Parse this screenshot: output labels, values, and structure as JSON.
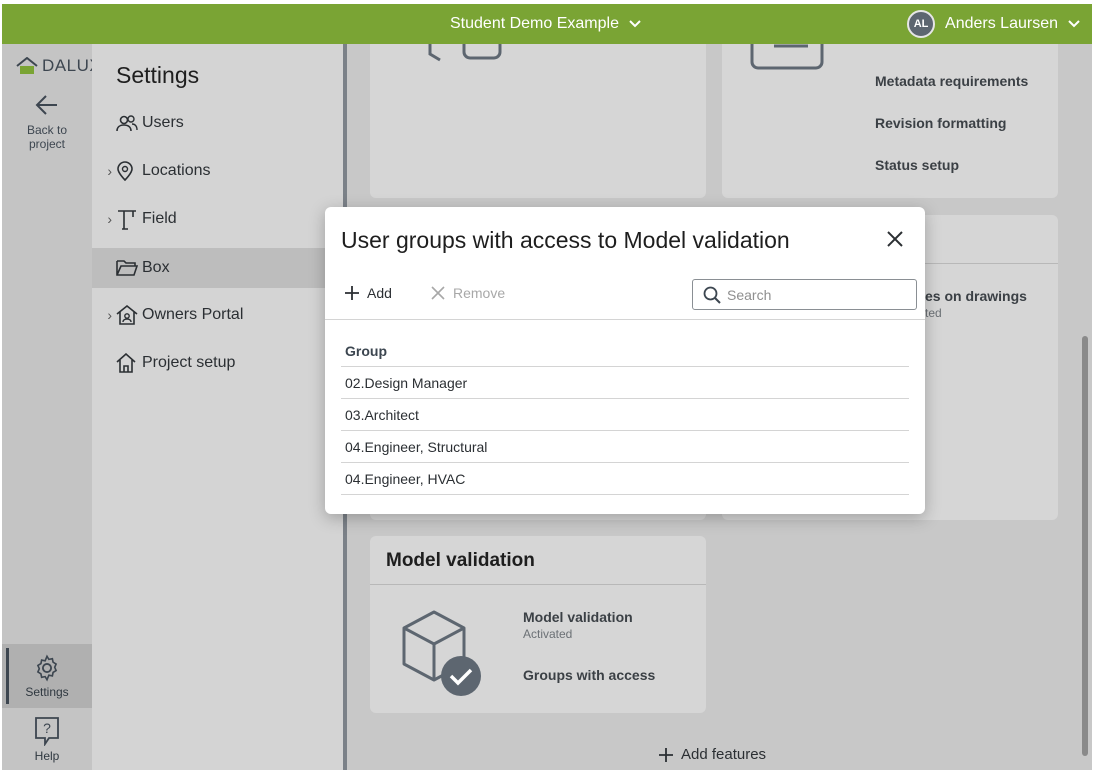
{
  "topbar": {
    "project": "Student Demo Example",
    "user_initials": "AL",
    "user_name": "Anders Laursen"
  },
  "rail": {
    "logo": "DALUX",
    "back_line1": "Back to",
    "back_line2": "project",
    "settings": "Settings",
    "help": "Help"
  },
  "nav": {
    "title": "Settings",
    "items": [
      {
        "label": "Users"
      },
      {
        "label": "Locations"
      },
      {
        "label": "Field"
      },
      {
        "label": "Box"
      },
      {
        "label": "Owners Portal"
      },
      {
        "label": "Project setup"
      }
    ]
  },
  "cards": {
    "top_right_links": [
      "Metadata requirements",
      "Revision formatting",
      "Status setup"
    ],
    "mid_right_link": "es on drawings",
    "mid_right_sub": "ted",
    "model_validation": {
      "title": "Model validation",
      "feature": "Model validation",
      "status": "Activated",
      "groups_link": "Groups with access"
    },
    "add_features": "Add features"
  },
  "modal": {
    "title": "User groups with access to Model validation",
    "add": "Add",
    "remove": "Remove",
    "search_placeholder": "Search",
    "column": "Group",
    "rows": [
      "02.Design Manager",
      "03.Architect",
      "04.Engineer, Structural",
      "04.Engineer, HVAC"
    ]
  },
  "colors": {
    "brand": "#7aa434",
    "overlay": "#c8c8c8"
  }
}
